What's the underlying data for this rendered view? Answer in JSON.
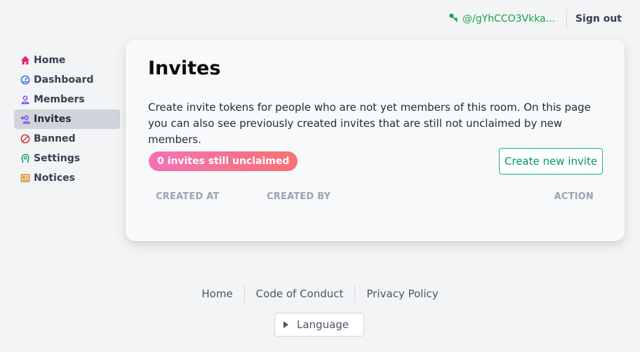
{
  "topbar": {
    "user_id": "@/gYhCCO3Vkka...",
    "sign_out": "Sign out"
  },
  "sidebar": {
    "items": [
      {
        "label": "Home",
        "icon": "home-icon"
      },
      {
        "label": "Dashboard",
        "icon": "dashboard-icon"
      },
      {
        "label": "Members",
        "icon": "user-icon"
      },
      {
        "label": "Invites",
        "icon": "user-plus-icon",
        "active": true
      },
      {
        "label": "Banned",
        "icon": "ban-icon"
      },
      {
        "label": "Settings",
        "icon": "settings-head-icon"
      },
      {
        "label": "Notices",
        "icon": "newspaper-icon"
      }
    ]
  },
  "main": {
    "title": "Invites",
    "description": "Create invite tokens for people who are not yet members of this room. On this page you can also see previously created invites that are still not unclaimed by new members.",
    "badge": "0 invites still unclaimed",
    "create_button": "Create new invite",
    "table": {
      "headers": [
        "CREATED AT",
        "CREATED BY",
        "ACTION"
      ],
      "rows": []
    }
  },
  "footer": {
    "links": [
      "Home",
      "Code of Conduct",
      "Privacy Policy"
    ],
    "language": "Language"
  },
  "colors": {
    "accent": "#10b981",
    "badge_gradient_start": "#f472b6",
    "badge_gradient_end": "#f87171"
  }
}
